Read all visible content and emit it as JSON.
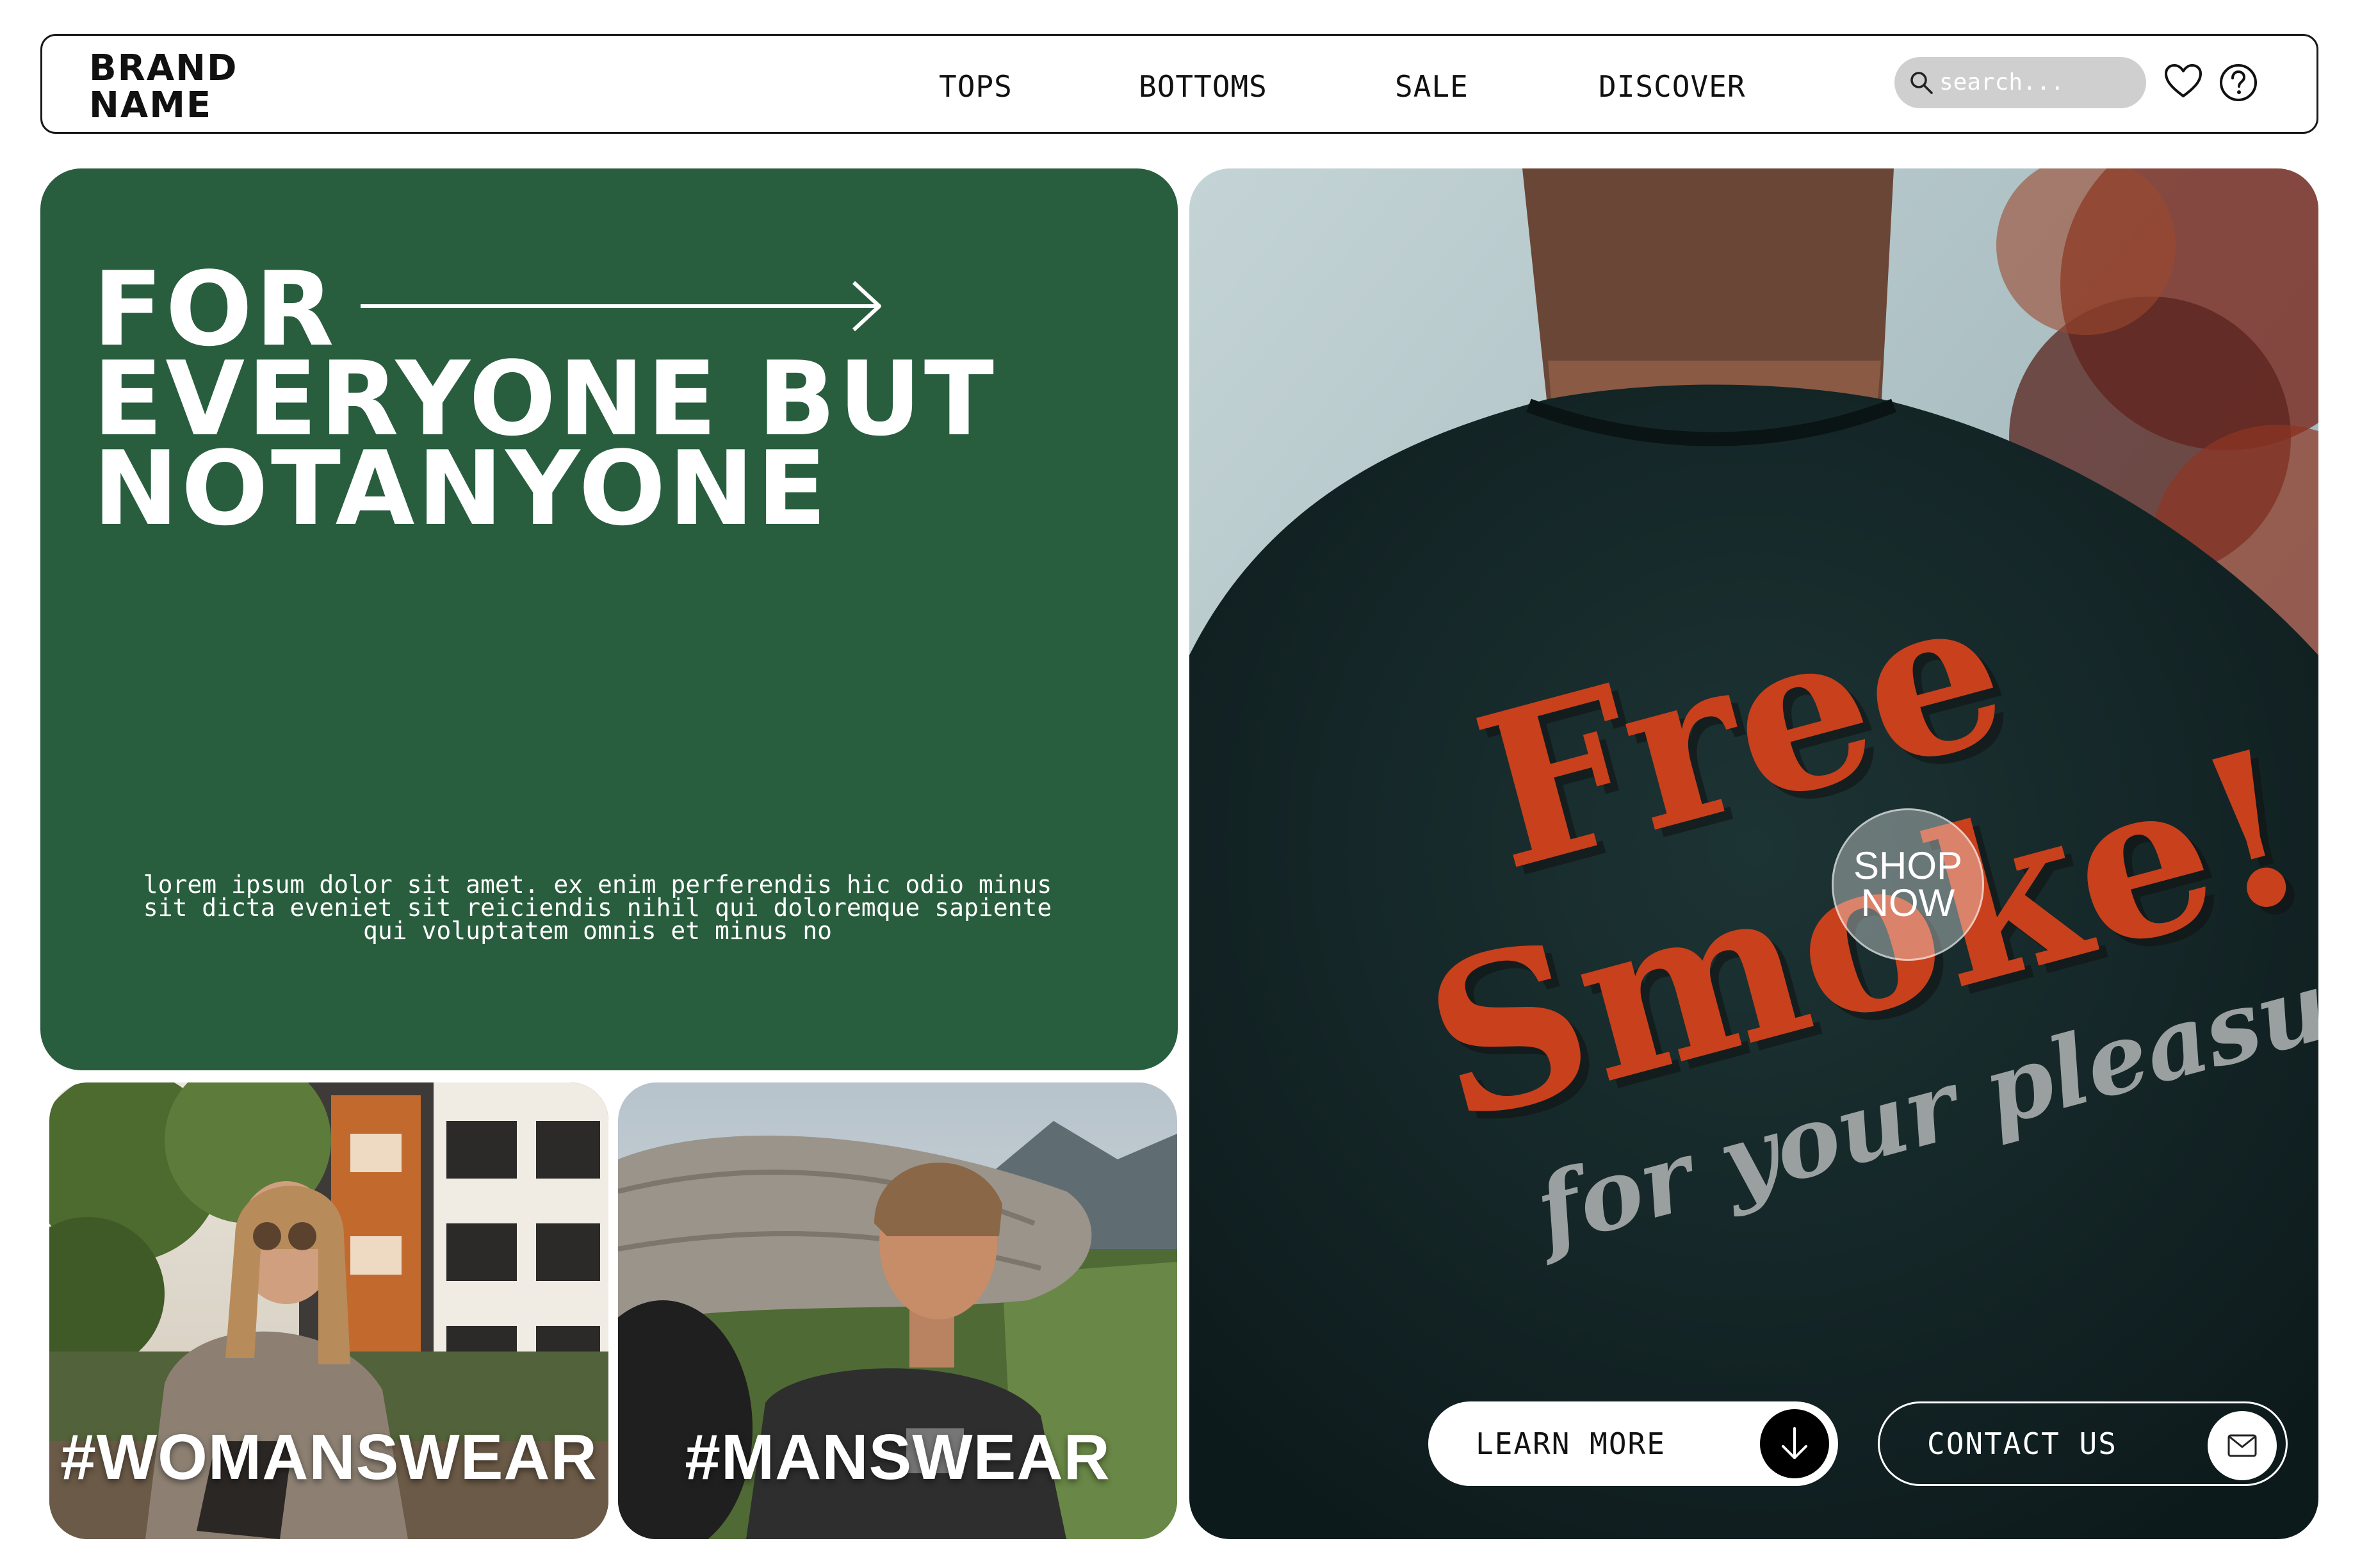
{
  "nav": {
    "brand": "BRAND\nNAME",
    "links": [
      "TOPS",
      "BOTTOMS",
      "SALE",
      "DISCOVER"
    ],
    "search_placeholder": "search...",
    "icons": [
      "search-icon",
      "heart-icon",
      "help-icon"
    ]
  },
  "hero": {
    "title_lines": [
      "FOR",
      "EVERYONE BUT",
      "NOTANYONE"
    ],
    "body": "lorem ipsum dolor sit amet. ex enim perferendis hic odio minus sit dicta eveniet sit reiciendis nihil qui doloremque sapiente qui voluptatem omnis et minus no",
    "background_color": "#285e3e"
  },
  "categories": [
    {
      "label": "#WOMANSWEAR"
    },
    {
      "label": "#MANSWEAR"
    }
  ],
  "feature": {
    "shirt_text_main": "Free Smoke!",
    "shirt_text_sub": "for your pleasure",
    "shop_now": "SHOP\nNOW",
    "learn_more": "LEARN MORE",
    "contact_us": "CONTACT US",
    "shirt_print_color": "#c8401c"
  }
}
